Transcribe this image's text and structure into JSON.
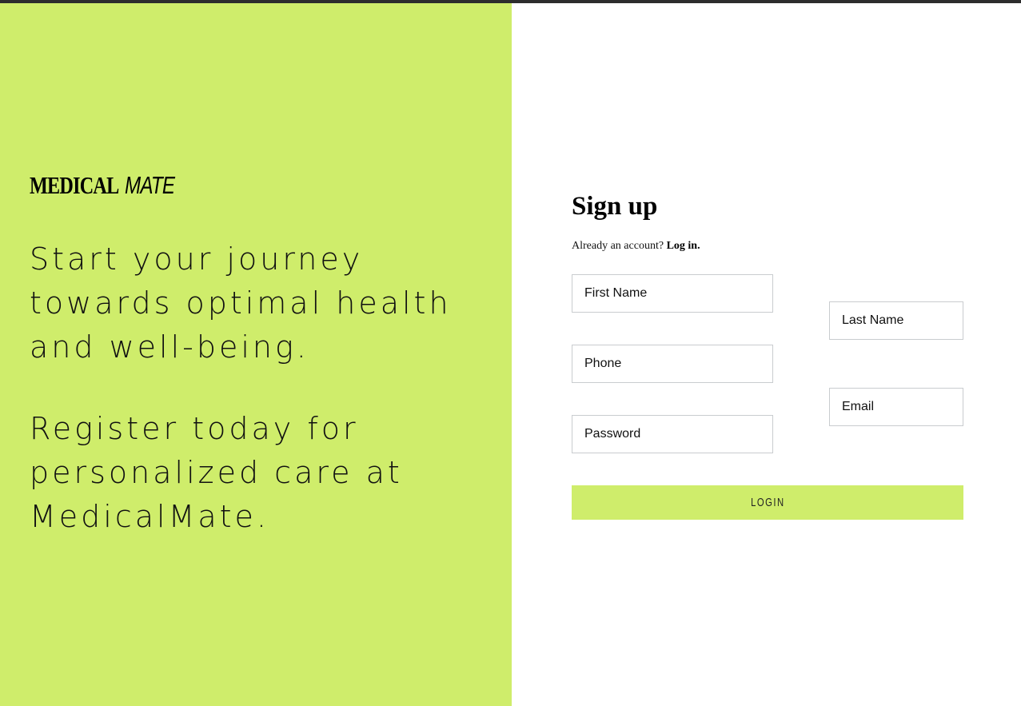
{
  "brand": {
    "name_bold": "MEDICAL",
    "name_light": "MATE",
    "accent_color": "#cfed6b"
  },
  "hero": {
    "line1": "Start your journey towards optimal health and well-being.",
    "line2": "Register today for personalized care at MedicalMate."
  },
  "signup": {
    "title": "Sign up",
    "account_prompt": "Already an account?",
    "login_link": "Log in.",
    "fields": {
      "first_name": {
        "placeholder": "First Name",
        "value": ""
      },
      "last_name": {
        "placeholder": "Last Name",
        "value": ""
      },
      "phone": {
        "placeholder": "Phone",
        "value": ""
      },
      "email": {
        "placeholder": "Email",
        "value": ""
      },
      "password": {
        "placeholder": "Password",
        "value": ""
      }
    },
    "submit_label": "LOGIN"
  }
}
